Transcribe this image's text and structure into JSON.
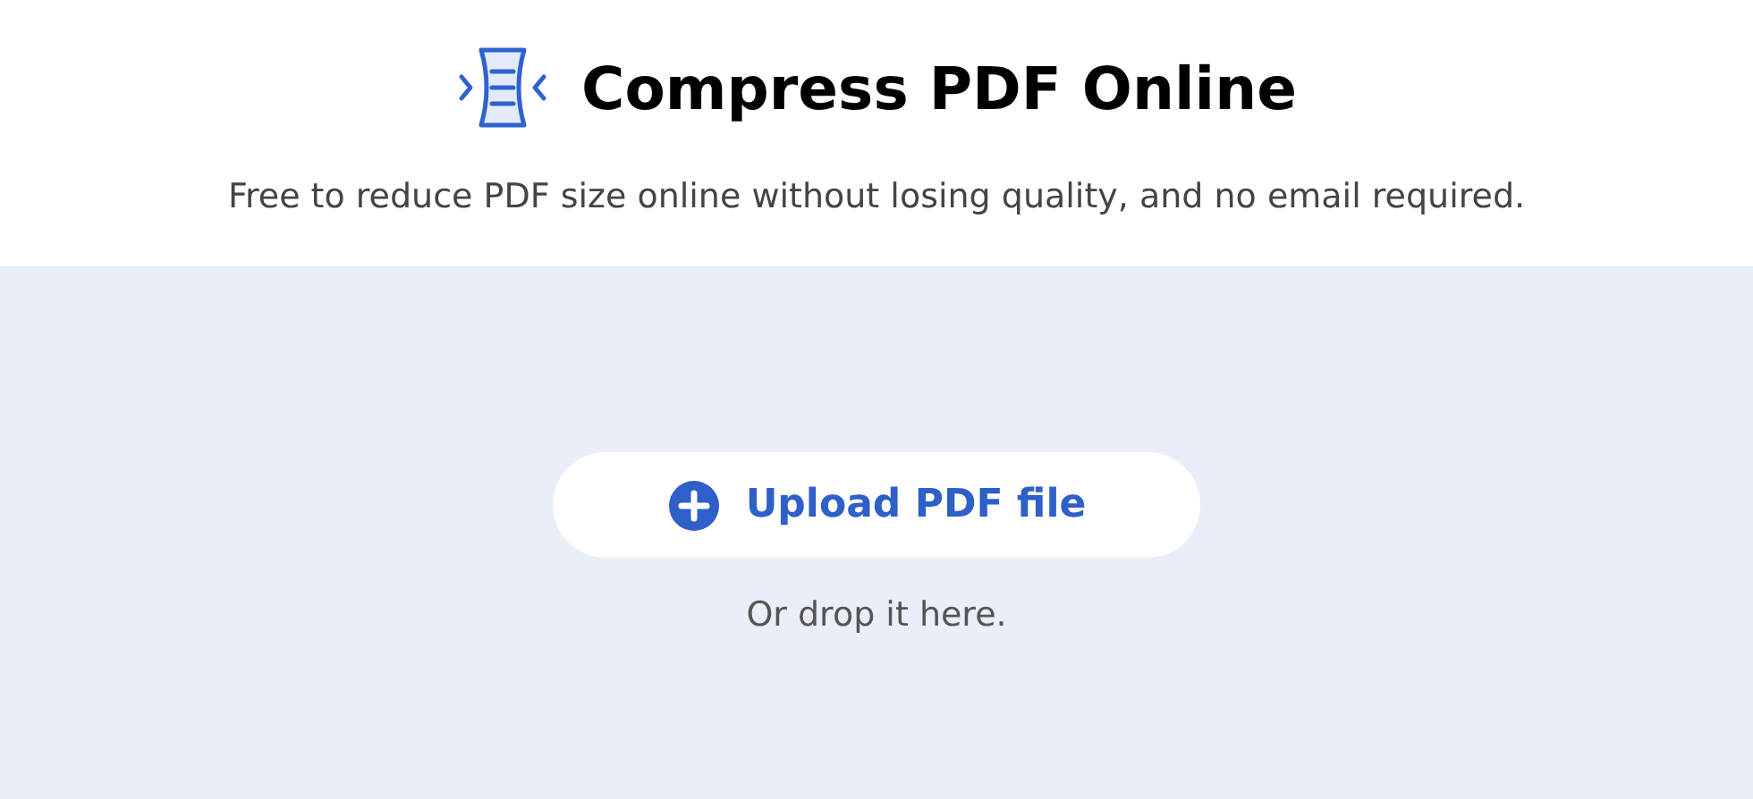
{
  "header": {
    "title": "Compress PDF Online",
    "subtitle": "Free to reduce PDF size online without losing quality, and no email required."
  },
  "upload": {
    "button": "Upload PDF file",
    "hint": "Or drop it here."
  }
}
